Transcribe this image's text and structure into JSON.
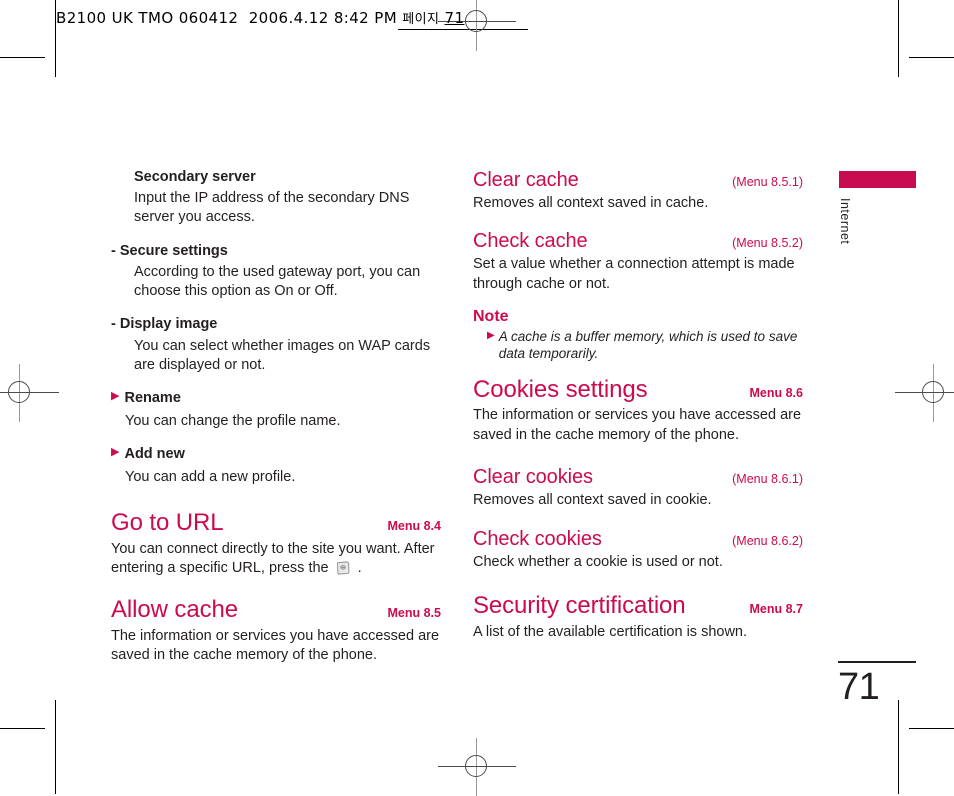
{
  "page": {
    "slug": {
      "code": "B2100 UK TMO 060412",
      "date": "2006.4.12",
      "time": "8:42 PM",
      "korean_page_word": "페이지",
      "page_number": "71"
    },
    "folio": "71",
    "margin_tab": "Internet"
  },
  "left_column": {
    "blocks": [
      {
        "heading": "Secondary server",
        "body": "Input the IP address of the secondary DNS server you access."
      },
      {
        "heading": "- Secure settings",
        "body": "According to the used gateway port, you can choose this option as On or Off."
      },
      {
        "heading": "- Display image",
        "body": "You can select whether images on WAP cards are displayed or not."
      }
    ],
    "bullets": [
      {
        "label": "Rename",
        "body": "You can change the profile name."
      },
      {
        "label": "Add new",
        "body": "You can add a new profile."
      }
    ],
    "sections": [
      {
        "title": "Go to URL",
        "menu": "Menu 8.4",
        "body_before_icon": "You can connect directly to the site you want. After entering a specific URL, press the",
        "icon_name": "phone-confirm-key-icon",
        "body_after_icon": "."
      },
      {
        "title": "Allow cache",
        "menu": "Menu 8.5",
        "body": "The information or services you have accessed are saved in the cache memory of the phone."
      }
    ]
  },
  "right_column": {
    "sections": [
      {
        "title": "Clear cache",
        "menu": "(Menu 8.5.1)",
        "body": "Removes all context saved in cache."
      },
      {
        "title": "Check cache",
        "menu": "(Menu 8.5.2)",
        "body": "Set a value whether a connection attempt is made through cache or not."
      }
    ],
    "note": {
      "title": "Note",
      "item": "A cache is a buffer memory, which is used to save data temporarily."
    },
    "sections2": [
      {
        "title": "Cookies settings",
        "menu": "Menu 8.6",
        "body": "The information or services you have accessed are saved in the cache memory of the phone."
      },
      {
        "title": "Clear cookies",
        "menu": "(Menu 8.6.1)",
        "body": "Removes all context saved in cookie."
      },
      {
        "title": "Check cookies",
        "menu": "(Menu 8.6.2)",
        "body": "Check whether a cookie is used or not."
      },
      {
        "title": "Security certification",
        "menu": "Menu 8.7",
        "body": "A list of the available certification is shown."
      }
    ]
  },
  "colors": {
    "accent": "#cc0b4e",
    "tab": "#c80a50",
    "text": "#231f20"
  }
}
